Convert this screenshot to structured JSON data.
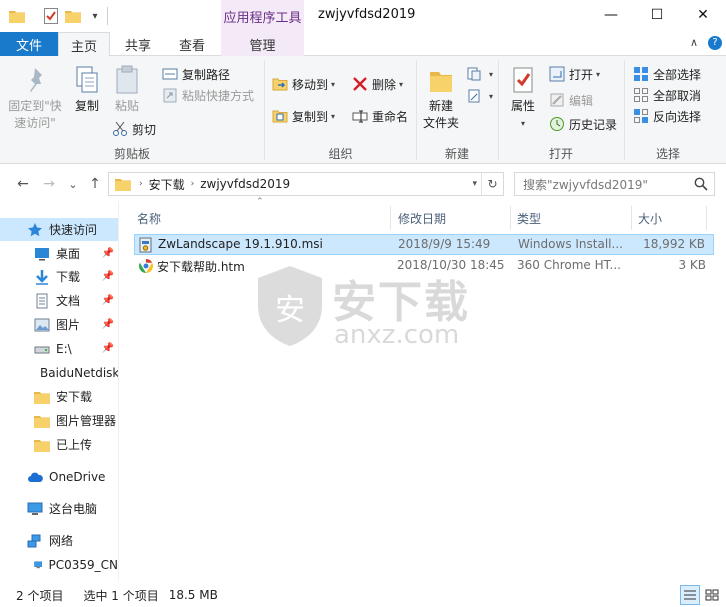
{
  "titlebar": {
    "context_tab": "应用程序工具",
    "title": "zwjyvfdsd2019",
    "minimize": "—",
    "maximize": "☐",
    "close": "✕"
  },
  "tabs": {
    "file": "文件",
    "home": "主页",
    "share": "共享",
    "view": "查看",
    "manage": "管理",
    "collapse": "∧",
    "help": "?"
  },
  "ribbon": {
    "clipboard": {
      "pin": "固定到\"快速访问\"",
      "copy": "复制",
      "paste": "粘贴",
      "copy_path": "复制路径",
      "paste_shortcut": "粘贴快捷方式",
      "cut": "剪切",
      "label": "剪贴板"
    },
    "organize": {
      "move_to": "移动到",
      "copy_to": "复制到",
      "delete": "删除",
      "rename": "重命名",
      "label": "组织"
    },
    "new": {
      "new_folder": "新建",
      "new_folder_2": "文件夹",
      "label": "新建"
    },
    "open": {
      "properties": "属性",
      "open": "打开",
      "edit": "编辑",
      "history": "历史记录",
      "label": "打开"
    },
    "select": {
      "select_all": "全部选择",
      "select_none": "全部取消",
      "invert": "反向选择",
      "label": "选择"
    }
  },
  "address": {
    "back": "←",
    "forward": "→",
    "recent": "⌄",
    "up": "↑",
    "segments": [
      "安下载",
      "zwjyvfdsd2019"
    ],
    "refresh": "↻",
    "search_placeholder": "搜索\"zwjyvfdsd2019\""
  },
  "nav": {
    "quick_access": "快速访问",
    "items": [
      {
        "label": "桌面",
        "pinned": true
      },
      {
        "label": "下载",
        "pinned": true
      },
      {
        "label": "文档",
        "pinned": true
      },
      {
        "label": "图片",
        "pinned": true
      },
      {
        "label": "E:\\",
        "pinned": true
      },
      {
        "label": "BaiduNetdisk",
        "pinned": false
      },
      {
        "label": "安下载",
        "pinned": false
      },
      {
        "label": "图片管理器",
        "pinned": false
      },
      {
        "label": "已上传",
        "pinned": false
      }
    ],
    "onedrive": "OneDrive",
    "this_pc": "这台电脑",
    "network": "网络",
    "pc": "PC0359_CN"
  },
  "list": {
    "columns": {
      "name": "名称",
      "date": "修改日期",
      "type": "类型",
      "size": "大小"
    },
    "rows": [
      {
        "name": "ZwLandscape 19.1.910.msi",
        "date": "2018/9/9 15:49",
        "type": "Windows Install...",
        "size": "18,992 KB",
        "selected": true
      },
      {
        "name": "安下载帮助.htm",
        "date": "2018/10/30 18:45",
        "type": "360 Chrome HT...",
        "size": "3 KB",
        "selected": false
      }
    ]
  },
  "watermark": {
    "brand": "安下载",
    "domain": "anxz.com",
    "badge": "安"
  },
  "status": {
    "count": "2 个项目",
    "selected": "选中 1 个项目",
    "size": "18.5 MB"
  }
}
